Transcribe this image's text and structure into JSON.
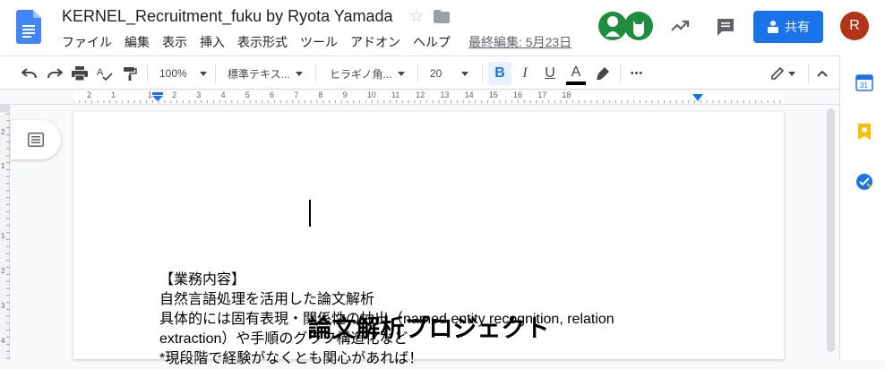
{
  "header": {
    "doc_title": "KERNEL_Recruitment_fuku by Ryota Yamada",
    "menu": [
      "ファイル",
      "編集",
      "表示",
      "挿入",
      "表示形式",
      "ツール",
      "アドオン",
      "ヘルプ"
    ],
    "last_edit": "最終編集: 5月23日",
    "share_label": "共有",
    "user_initial": "R"
  },
  "toolbar": {
    "zoom": "100%",
    "style": "標準テキス...",
    "font": "ヒラギノ角...",
    "font_size": "20",
    "bold": "B",
    "italic": "I",
    "underline": "U",
    "text_color": "A",
    "more": "•••"
  },
  "ruler": {
    "labels": [
      "2",
      "1",
      "1",
      "2",
      "3",
      "4",
      "5",
      "6",
      "7",
      "8",
      "9",
      "10",
      "11",
      "12",
      "13",
      "14",
      "15",
      "16",
      "17",
      "18"
    ]
  },
  "document": {
    "heading": "論文解析プロジェクト",
    "lines": [
      "【業務内容】",
      "自然言語処理を活用した論文解析",
      "具体的には固有表現・関係性の抽出（named entity recognition, relation",
      "extraction）や手順のグラフ構造化など",
      "*現段階で経験がなくとも関心があれば！"
    ]
  },
  "colors": {
    "accent": "#1a73e8",
    "docs_blue": "#4285f4",
    "avatar_red": "#b23419",
    "avatar_green": "#1e8e3e"
  }
}
